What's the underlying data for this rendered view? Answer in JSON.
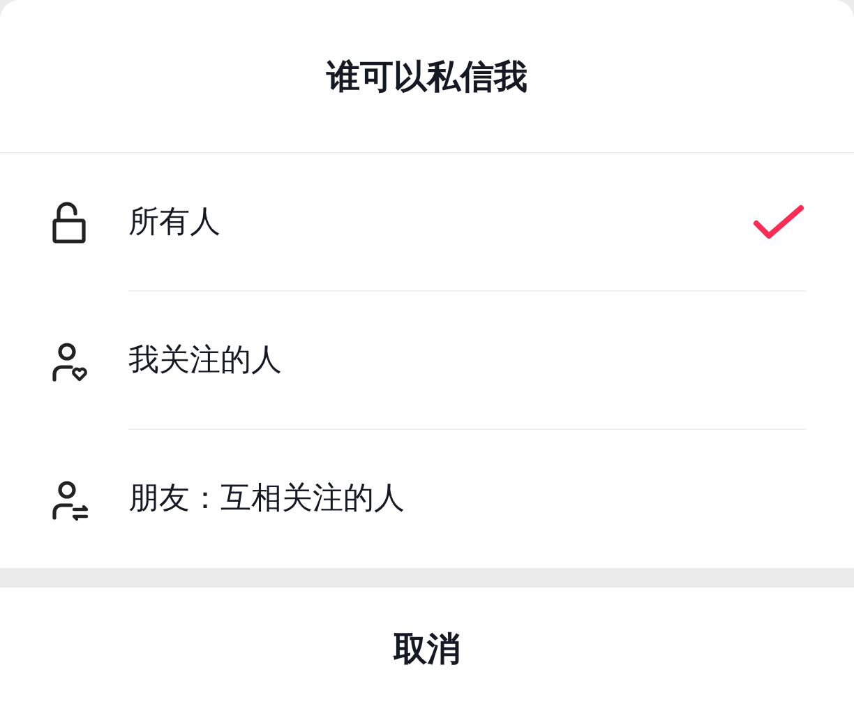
{
  "title": "谁可以私信我",
  "options": [
    {
      "label": "所有人",
      "kind": "everyone",
      "selected": true
    },
    {
      "label": "我关注的人",
      "kind": "following",
      "selected": false
    },
    {
      "label": "朋友：互相关注的人",
      "kind": "friends",
      "selected": false
    }
  ],
  "cancel": "取消"
}
